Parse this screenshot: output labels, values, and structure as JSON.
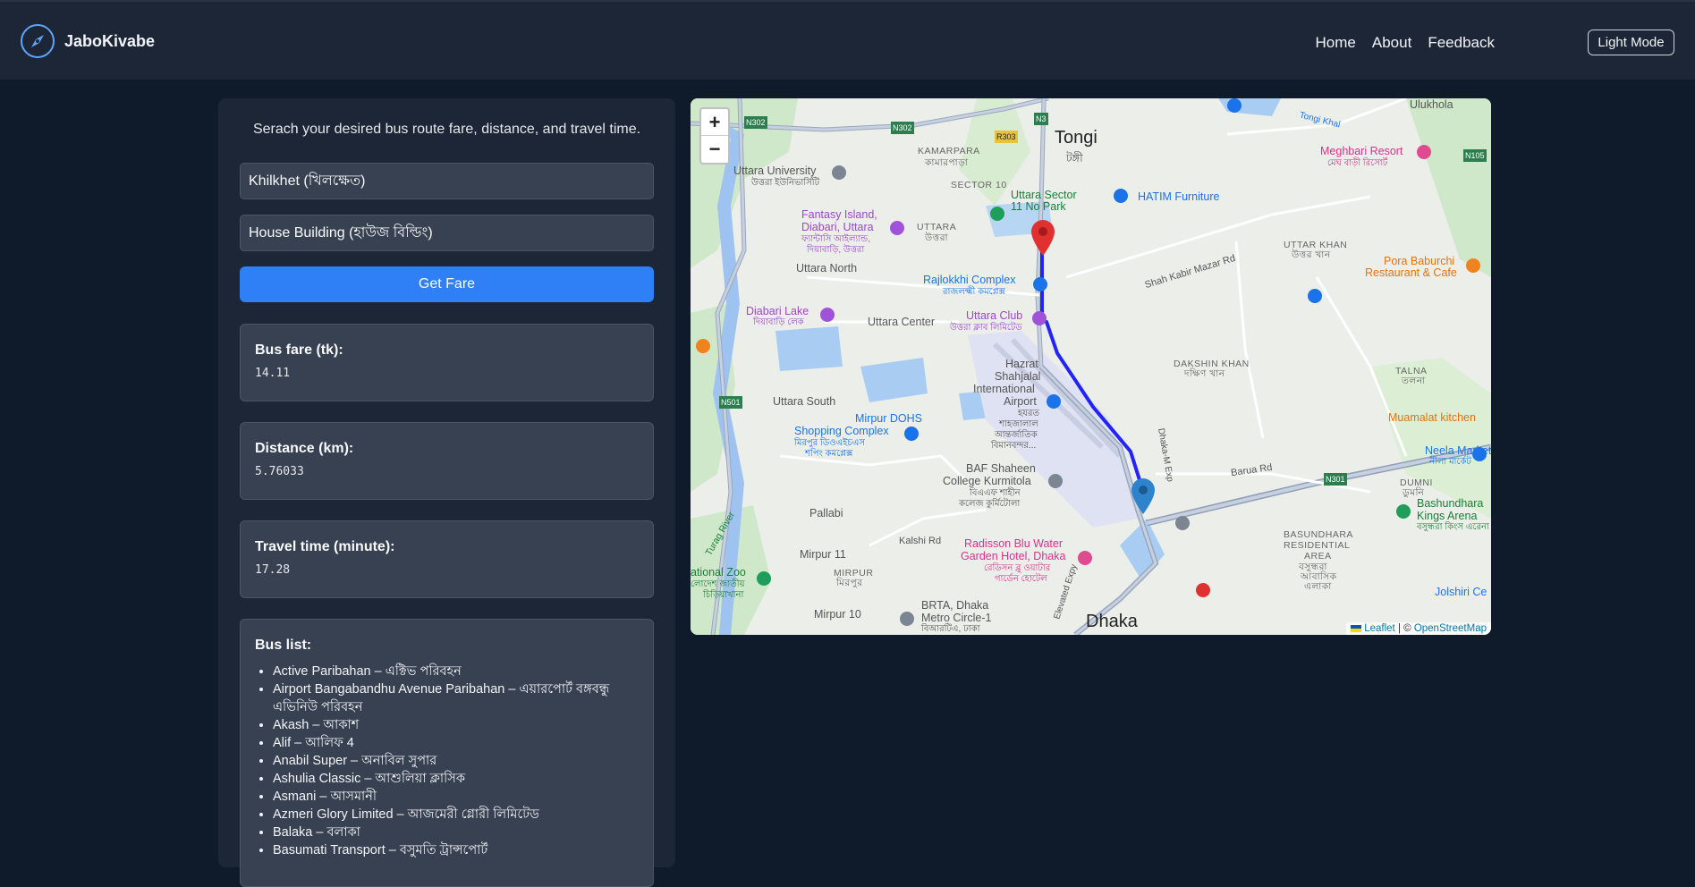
{
  "app": {
    "brand": "JaboKivabe",
    "nav": [
      "Home",
      "About",
      "Feedback"
    ],
    "mode_button": "Light Mode"
  },
  "search": {
    "tagline": "Serach your desired bus route fare, distance, and travel time.",
    "from_value": "Khilkhet (খিলক্ষেত)",
    "to_value": "House Building (হাউজ বিল্ডিং)",
    "submit_label": "Get Fare"
  },
  "results": {
    "fare_label": "Bus fare (tk):",
    "fare_value": "14.11",
    "distance_label": "Distance (km):",
    "distance_value": "5.76033",
    "time_label": "Travel time (minute):",
    "time_value": "17.28",
    "bus_list_label": "Bus list:",
    "buses": [
      "Active Paribahan – এক্টিভ পরিবহন",
      "Airport Bangabandhu Avenue Paribahan – এয়ারপোর্ট বঙ্গবন্ধু এভিনিউ পরিবহন",
      "Akash – আকাশ",
      "Alif – আলিফ 4",
      "Anabil Super – অনাবিল সুপার",
      "Ashulia Classic – আশুলিয়া ক্লাসিক",
      "Asmani – আসমানী",
      "Azmeri Glory Limited – আজমেরী গ্লোরী লিমিটেড",
      "Balaka – বলাকা",
      "Basumati Transport – বসুমতি ট্রান্সপোর্ট"
    ]
  },
  "map": {
    "zoom_in": "+",
    "zoom_out": "−",
    "attribution_leaflet": "Leaflet",
    "attribution_sep": "| ©",
    "attribution_osm": "OpenStreetMap",
    "labels": {
      "tongi": "Tongi",
      "tongi_bn": "টঙ্গী",
      "kamarpara": "KAMARPARA",
      "kamarpara_bn": "কামারপাড়া",
      "sector10": "SECTOR 10",
      "uttara_university": "Uttara University",
      "uttara_university_bn": "উত্তরা ইউনিভার্সিটি",
      "fantasy_island": "Fantasy Island,",
      "fantasy_island2": "Diabari, Uttara",
      "fantasy_island_bn": "ফ্যান্টাসি আইল্যান্ড,",
      "fantasy_island_bn2": "দিয়াবাড়ি, উত্তরা",
      "uttara_sector": "Uttara Sector",
      "uttara_sector2": "11 No Park",
      "uttara": "UTTARA",
      "uttara_bn": "উত্তরা",
      "uttara_north": "Uttara North",
      "rajlokkhi": "Rajlokkhi Complex",
      "rajlokkhi_bn": "রাজলক্ষ্মী কমপ্লেক্স",
      "diabari_lake": "Diabari Lake",
      "diabari_lake_bn": "দিয়াবাড়ি লেক",
      "uttara_center": "Uttara Center",
      "uttara_club": "Uttara Club",
      "uttara_club_bn": "উত্তরা ক্লাব লিমিটেড",
      "hatim": "HATIM Furniture",
      "shah_kabir": "Shah Kabir Mazar Rd",
      "uttar_khan": "UTTAR KHAN",
      "uttar_khan_bn": "উত্তর খান",
      "meghbari": "Meghbari Resort",
      "meghbari_bn": "মেঘ বাড়ী রিসোর্ট",
      "pora_baburchi": "Pora Baburchi",
      "pora_baburchi2": "Restaurant & Cafe",
      "dakshin_khan": "DAKSHIN KHAN",
      "dakshin_khan_bn": "দক্ষিণ খান",
      "talna": "TALNA",
      "talna_bn": "তলনা",
      "hazrat": "Hazrat",
      "hazrat2": "Shahjalal",
      "hazrat3": "International",
      "hazrat4": "Airport",
      "hazrat_bn": "হযরত",
      "hazrat_bn2": "শাহজালাল",
      "hazrat_bn3": "আন্তর্জাতিক",
      "hazrat_bn4": "বিমানবন্দর...",
      "uttara_south": "Uttara South",
      "mirpur_dohs": "Mirpur DOHS",
      "mirpur_dohs2": "Shopping Complex",
      "mirpur_dohs_bn": "মিরপুর ডিওএইচএস",
      "mirpur_dohs_bn2": "শপিং কমপ্লেক্স",
      "baf": "BAF Shaheen",
      "baf2": "College Kurmitola",
      "baf_bn": "বিএএফ শাহীন",
      "baf_bn2": "কলেজ কুর্মিটোলা",
      "muamalat": "Muamalat kitchen",
      "neela": "Neela Market",
      "neela_bn": "নীলা মার্কেট",
      "barua": "Barua Rd",
      "dumni": "DUMNI",
      "dumni_bn": "ডুমনি",
      "bashundhara_kings": "Bashundhara",
      "bashundhara_kings2": "Kings Arena",
      "bashundhara_kings_bn": "বসুন্ধরা কিংস এরেনা",
      "pallabi": "Pallabi",
      "kalshi": "Kalshi Rd",
      "radisson": "Radisson Blu Water",
      "radisson2": "Garden Hotel, Dhaka",
      "radisson_bn": "রেডিসন ব্লু ওয়াটার",
      "radisson_bn2": "গার্ডেন হোটেল",
      "bashundhara_res": "BASUNDHARA",
      "bashundhara_res2": "RESIDENTIAL",
      "bashundhara_res3": "AREA",
      "bashundhara_res_bn": "বসুন্ধরা",
      "bashundhara_res_bn2": "আবাসিক",
      "bashundhara_res_bn3": "এলাকা",
      "mirpur11": "Mirpur 11",
      "mirpur": "MIRPUR",
      "mirpur_bn": "মিরপুর",
      "national_zoo": "ational Zoo",
      "national_zoo_bn": "লোদেশ জাতীয়",
      "national_zoo_bn2": "চিড়িয়াখানা",
      "turag": "Turag River",
      "brta": "BRTA, Dhaka",
      "brta2": "Metro Circle-1",
      "brta_bn": "বিআরটিএ, ঢাকা",
      "mirpur10": "Mirpur 10",
      "dhaka": "Dhaka",
      "jolshiri": "Jolshiri Ce",
      "ulukhola": "Ulukhola",
      "tongi_khal": "Tongi Khal",
      "dhaka_exp": "Dhaka-M Exp",
      "elevated": "Elevated Expy",
      "n302": "N302",
      "n302b": "N302",
      "r303": "R303",
      "n3": "N3",
      "n501": "N501",
      "n301": "N301",
      "n105": "N105"
    }
  }
}
